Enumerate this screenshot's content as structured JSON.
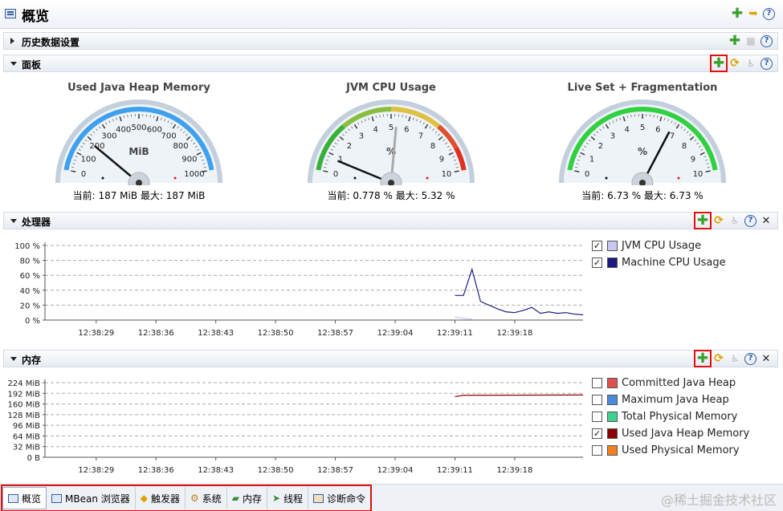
{
  "title": "概览",
  "sections": {
    "history": "历史数据设置",
    "dashboard": "面板",
    "processor": "处理器",
    "memory": "内存"
  },
  "gauges": [
    {
      "title": "Used Java Heap Memory",
      "unit": "MiB",
      "ticks": [
        "0",
        "100",
        "200",
        "300",
        "400",
        "500",
        "600",
        "700",
        "800",
        "900",
        "1000"
      ],
      "current": 187,
      "max": 187,
      "value_text": "当前: 187 MiB  最大: 187 MiB"
    },
    {
      "title": "JVM CPU Usage",
      "unit": "%",
      "ticks": [
        "0",
        "1",
        "2",
        "3",
        "4",
        "5",
        "6",
        "7",
        "8",
        "9",
        "10"
      ],
      "current": 0.778,
      "max": 5.32,
      "value_text": "当前: 0.778 %  最大: 5.32 %"
    },
    {
      "title": "Live Set + Fragmentation",
      "unit": "%",
      "ticks": [
        "0",
        "1",
        "2",
        "3",
        "4",
        "5",
        "6",
        "7",
        "8",
        "9",
        "10"
      ],
      "current": 6.73,
      "max": 6.73,
      "value_text": "当前: 6.73 %  最大: 6.73 %"
    }
  ],
  "chart_data": [
    {
      "type": "line",
      "y_ticks": [
        "0 %",
        "20 %",
        "40 %",
        "60 %",
        "80 %",
        "100 %"
      ],
      "x_ticks": [
        "12:38:29",
        "12:38:36",
        "12:38:43",
        "12:38:50",
        "12:38:57",
        "12:39:04",
        "12:39:11",
        "12:39:18"
      ],
      "ylim": [
        0,
        100
      ],
      "series": [
        {
          "name": "JVM CPU Usage",
          "color": "#c8c8f0",
          "x": [
            "12:39:11",
            "12:39:13"
          ],
          "values": [
            4,
            1
          ]
        },
        {
          "name": "Machine CPU Usage",
          "color": "#1a1a80",
          "x": [
            "12:39:11",
            "12:39:12",
            "12:39:13",
            "12:39:14",
            "12:39:15",
            "12:39:16",
            "12:39:17",
            "12:39:18",
            "12:39:19",
            "12:39:20",
            "12:39:21",
            "12:39:22",
            "12:39:23",
            "12:39:24",
            "12:39:25",
            "12:39:26"
          ],
          "values": [
            33,
            33,
            68,
            25,
            20,
            15,
            11,
            10,
            13,
            17,
            9,
            11,
            9,
            10,
            8,
            7
          ]
        }
      ],
      "legend": [
        {
          "label": "JVM CPU Usage",
          "checked": true,
          "color": "#c8c8f0"
        },
        {
          "label": "Machine CPU Usage",
          "checked": true,
          "color": "#1a1a80"
        }
      ]
    },
    {
      "type": "line",
      "y_ticks": [
        "0 B",
        "32 MiB",
        "64 MiB",
        "96 MiB",
        "128 MiB",
        "160 MiB",
        "192 MiB",
        "224 MiB"
      ],
      "x_ticks": [
        "12:38:29",
        "12:38:36",
        "12:38:43",
        "12:38:50",
        "12:38:57",
        "12:39:04",
        "12:39:11",
        "12:39:18"
      ],
      "ylim": [
        0,
        224
      ],
      "series": [
        {
          "name": "Used Java Heap Memory",
          "color": "#8b0000",
          "x": [
            "12:39:11",
            "12:39:12",
            "12:39:26"
          ],
          "values": [
            182,
            186,
            187
          ]
        }
      ],
      "legend": [
        {
          "label": "Committed Java Heap",
          "checked": false,
          "color": "#e05050"
        },
        {
          "label": "Maximum Java Heap",
          "checked": false,
          "color": "#4a8ad8"
        },
        {
          "label": "Total Physical Memory",
          "checked": false,
          "color": "#40d090"
        },
        {
          "label": "Used Java Heap Memory",
          "checked": true,
          "color": "#8b0000"
        },
        {
          "label": "Used Physical Memory",
          "checked": false,
          "color": "#f08020"
        }
      ]
    }
  ],
  "bottom_tabs": [
    "概览",
    "MBean 浏览器",
    "触发器",
    "系统",
    "内存",
    "线程",
    "诊断命令"
  ],
  "watermark": "@稀土掘金技术社区"
}
